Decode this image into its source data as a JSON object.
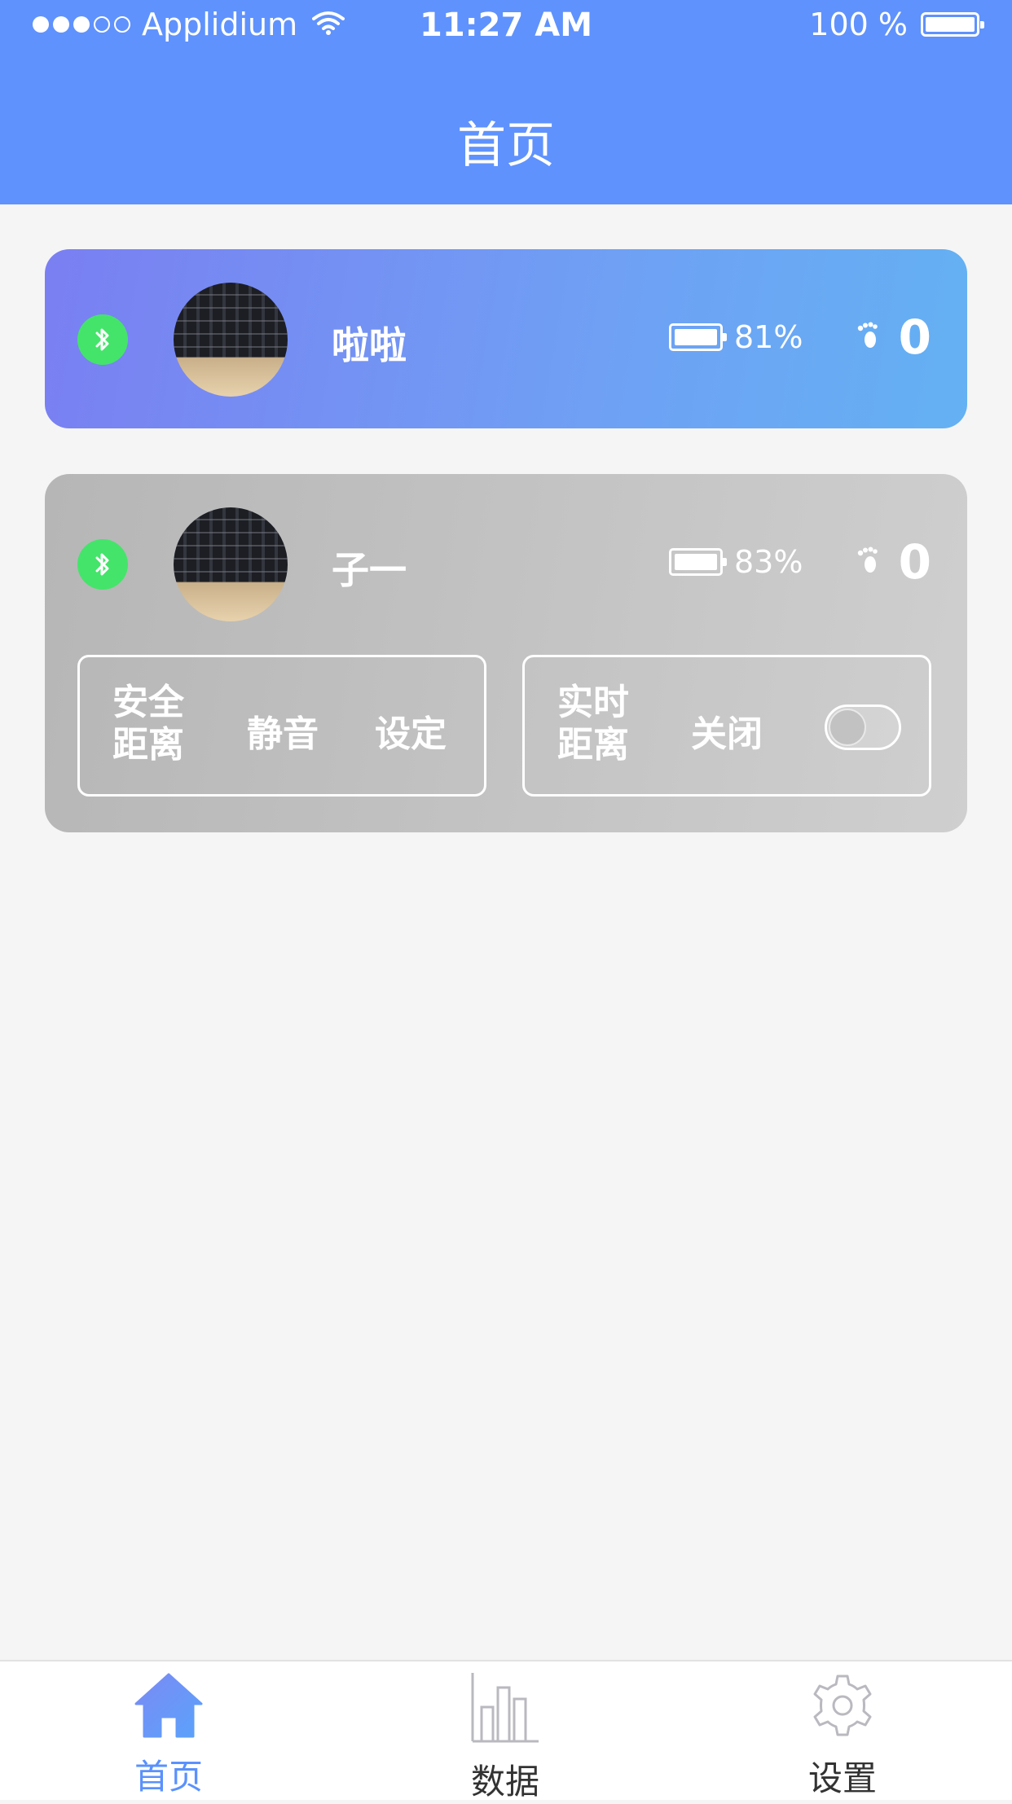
{
  "status_bar": {
    "carrier": "Applidium",
    "time": "11:27 AM",
    "battery": "100 %"
  },
  "header": {
    "title": "首页"
  },
  "devices": [
    {
      "name": "啦啦",
      "battery": "81%",
      "steps": "0",
      "bluetooth_connected": true
    },
    {
      "name": "子一",
      "battery": "83%",
      "steps": "0",
      "bluetooth_connected": true,
      "safe_distance": {
        "label": "安全距离",
        "label_line1": "安全",
        "label_line2": "距离",
        "mute_label": "静音",
        "settings_label": "设定"
      },
      "realtime_distance": {
        "label_line1": "实时",
        "label_line2": "距离",
        "state_label": "关闭",
        "enabled": false
      }
    }
  ],
  "tabs": [
    {
      "label": "首页",
      "active": true,
      "icon": "home-icon"
    },
    {
      "label": "数据",
      "active": false,
      "icon": "bar-chart-icon"
    },
    {
      "label": "设置",
      "active": false,
      "icon": "gear-icon"
    }
  ],
  "colors": {
    "primary": "#5f92fd",
    "bluetooth": "#44e46a",
    "active_card_start": "#7a7ff2",
    "active_card_end": "#64b1f3",
    "inactive_card": "#c2c2c2",
    "background": "#f5f5f6"
  }
}
